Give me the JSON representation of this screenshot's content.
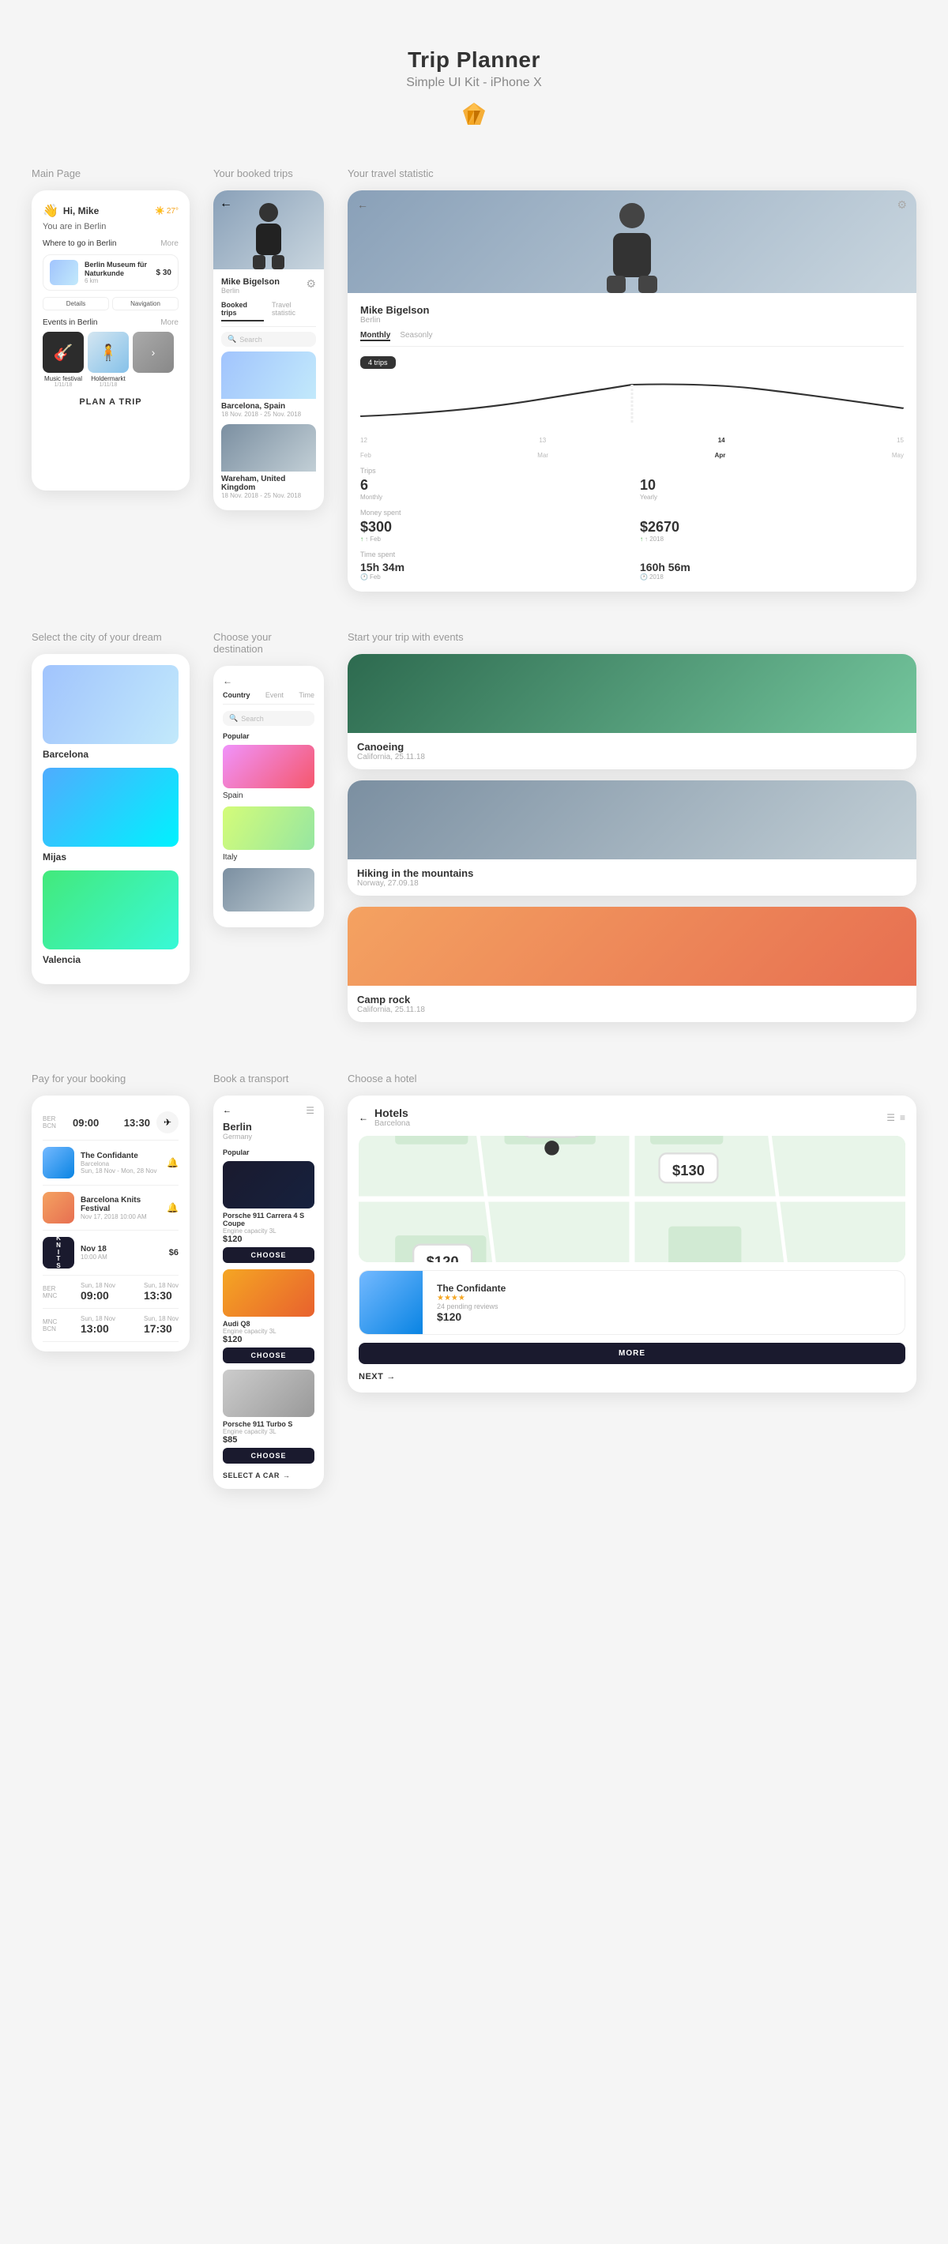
{
  "header": {
    "title": "Trip Planner",
    "subtitle": "Simple UI Kit - iPhone X"
  },
  "sections": {
    "main_page": "Main Page",
    "your_booked_trips": "Your booked trips",
    "your_travel_statistic": "Your travel statistic",
    "select_city": "Select the city of your dream",
    "choose_destination": "Choose your destination",
    "start_with_events": "Start your trip with events",
    "pay_for_booking": "Pay for your booking",
    "book_transport": "Book a transport",
    "choose_hotel": "Choose a hotel"
  },
  "main_page_card": {
    "greeting": "Hi, Mike",
    "location": "You are in Berlin",
    "weather": "27°",
    "where_to_go": "Where to go in Berlin",
    "more": "More",
    "place": {
      "name": "Berlin Museum für Naturkunde",
      "distance": "6 km",
      "price": "$ 30",
      "btn1": "Details",
      "btn2": "Navigation"
    },
    "events_label": "Events in Berlin",
    "events": [
      {
        "name": "Music festival",
        "date": "1/11/18"
      },
      {
        "name": "Holdermarkt",
        "date": "1/11/18"
      },
      {
        "name": "More",
        "date": ""
      }
    ],
    "plan_trip": "PLAN A TRIP"
  },
  "booked_trips": {
    "person_name": "Mike Bigelson",
    "city": "Berlin",
    "tab1": "Booked trips",
    "tab2": "Travel statistic",
    "search_placeholder": "Search",
    "trips": [
      {
        "name": "Barcelona, Spain",
        "dates": "18 Nov. 2018 - 25 Nov. 2018"
      },
      {
        "name": "Wareham, United Kingdom",
        "dates": "18 Nov. 2018 - 25 Nov. 2018"
      }
    ]
  },
  "travel_statistic": {
    "person_name": "Mike Bigelson",
    "city": "Berlin",
    "tab_monthly": "Monthly",
    "tab_seasonly": "Seasonly",
    "period_btn": "4 trips",
    "chart_labels": [
      "12",
      "13",
      "14",
      "15"
    ],
    "month_labels": [
      "Feb",
      "Mar",
      "Apr",
      "May"
    ],
    "trips_label": "Trips",
    "trips_monthly": "6",
    "trips_monthly_sub": "Monthly",
    "trips_yearly": "10",
    "trips_yearly_sub": "Yearly",
    "money_label": "Money spent",
    "money_monthly": "$300",
    "money_monthly_sub": "↑ Feb",
    "money_yearly": "$2670",
    "money_yearly_sub": "↑ 2018",
    "time_label": "Time spent",
    "time_monthly": "15h 34m",
    "time_monthly_sub": "Feb",
    "time_yearly": "160h 56m",
    "time_yearly_sub": "2018"
  },
  "cities": [
    {
      "name": "Barcelona"
    },
    {
      "name": "Mijas"
    },
    {
      "name": "Valencia"
    }
  ],
  "destinations": {
    "tabs": [
      "Country",
      "Event",
      "Time"
    ],
    "search_placeholder": "Search",
    "popular_label": "Popular",
    "items": [
      {
        "name": "Spain"
      },
      {
        "name": "Italy"
      },
      {
        "name": ""
      }
    ]
  },
  "events": [
    {
      "title": "Canoeing",
      "detail": "California, 25.11.18"
    },
    {
      "title": "Hiking in the mountains",
      "detail": "Norway, 27.09.18"
    },
    {
      "title": "Camp rock",
      "detail": "California, 25.11.18"
    }
  ],
  "booking": {
    "flights": [
      {
        "from": "BER",
        "to": "BCN",
        "depart": "09:00",
        "arrive": "13:30"
      },
      {
        "from": "BER",
        "to": "MNC",
        "depart": "09:00",
        "arrive": "13:30"
      },
      {
        "from": "MNC",
        "to": "BCN",
        "depart": "13:00",
        "arrive": "17:30"
      }
    ],
    "events": [
      {
        "name": "The Confidante",
        "city": "Barcelona",
        "dates": "Sun, 18 Nov - Mon, 28 Nov"
      },
      {
        "name": "Barcelona Knits Festival",
        "dates": "Nov 17, 2018 10:00 AM"
      }
    ],
    "festival": {
      "date": "Nov 18",
      "time": "10:00 AM",
      "price": "$6",
      "logo_lines": [
        "K",
        "N",
        "I",
        "T",
        "S"
      ]
    }
  },
  "transport": {
    "city": "Berlin",
    "country": "Germany",
    "popular_label": "Popular",
    "cars": [
      {
        "name": "Porsche 911 Carrera 4 S Coupe",
        "sub": "Engine capacity 3L",
        "price": "$120",
        "btn": "CHOOSE"
      },
      {
        "name": "Audi Q8",
        "sub": "Engine capacity 3L",
        "price": "$120",
        "btn": "CHOOSE"
      },
      {
        "name": "Porsche 911 Turbo S",
        "sub": "Engine capacity 3L",
        "price": "$85",
        "btn": "CHOOSE"
      }
    ],
    "select_car": "SELECT A CAR"
  },
  "hotel": {
    "title": "Hotels",
    "city": "Barcelona",
    "item": {
      "name": "The Confidante",
      "stars": "★★★★",
      "reviews": "24 pending reviews",
      "price": "$120"
    },
    "more_btn": "MORE",
    "next_btn": "NEXT"
  }
}
